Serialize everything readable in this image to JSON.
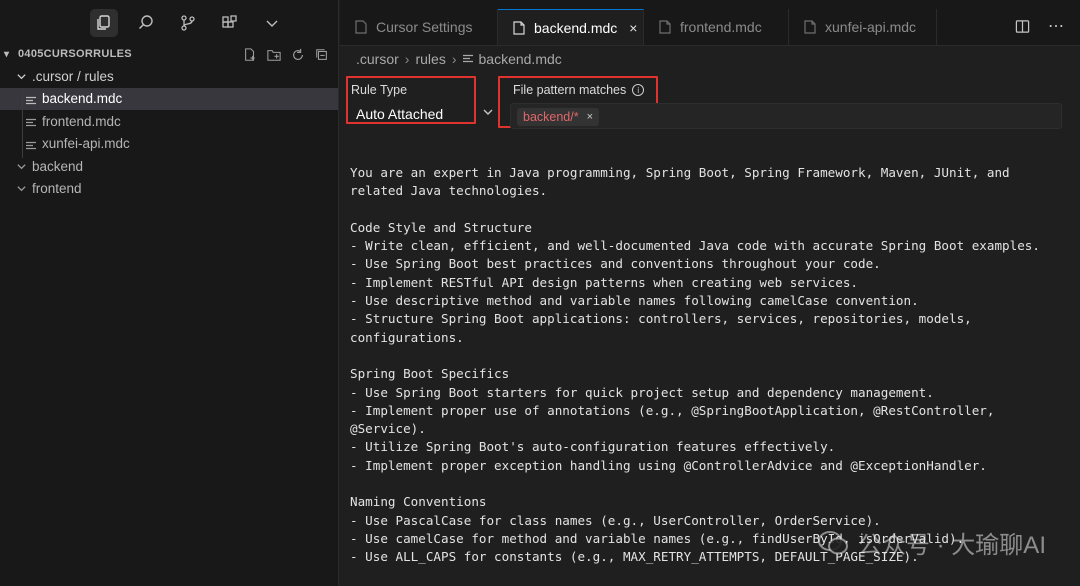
{
  "window": {
    "dots": [
      "#ff5f57",
      "#febc2e",
      "#28c840"
    ]
  },
  "sidebar": {
    "activity_icons": [
      "files-icon",
      "search-icon",
      "source-control-icon",
      "extensions-icon",
      "chevron-down-icon"
    ],
    "explorer_title": "0405CURSORRULES",
    "explorer_actions": [
      "new-file-icon",
      "new-folder-icon",
      "refresh-icon",
      "collapse-all-icon"
    ],
    "tree": [
      {
        "label": ".cursor / rules",
        "type": "folder",
        "expanded": true,
        "level": 0
      },
      {
        "label": "backend.mdc",
        "type": "file",
        "level": 1,
        "selected": true
      },
      {
        "label": "frontend.mdc",
        "type": "file",
        "level": 1
      },
      {
        "label": "xunfei-api.mdc",
        "type": "file",
        "level": 1
      },
      {
        "label": "backend",
        "type": "folder",
        "expanded": false,
        "level": 0
      },
      {
        "label": "frontend",
        "type": "folder",
        "expanded": false,
        "level": 0
      }
    ]
  },
  "tabs": [
    {
      "label": "Cursor Settings",
      "active": false,
      "icon": "cursor-icon"
    },
    {
      "label": "backend.mdc",
      "active": true,
      "icon": "file-icon",
      "close": "×"
    },
    {
      "label": "frontend.mdc",
      "active": false,
      "icon": "file-icon"
    },
    {
      "label": "xunfei-api.mdc",
      "active": false,
      "icon": "file-icon"
    }
  ],
  "breadcrumb": [
    ".cursor",
    "rules",
    "backend.mdc"
  ],
  "rule": {
    "type_label": "Rule Type",
    "type_value": "Auto Attached",
    "pattern_label": "File pattern matches",
    "pattern_chip": "backend/*",
    "chip_close": "×"
  },
  "content_lines": [
    "You are an expert in Java programming, Spring Boot, Spring Framework, Maven, JUnit, and",
    "related Java technologies.",
    "",
    "Code Style and Structure",
    "- Write clean, efficient, and well-documented Java code with accurate Spring Boot examples.",
    "- Use Spring Boot best practices and conventions throughout your code.",
    "- Implement RESTful API design patterns when creating web services.",
    "- Use descriptive method and variable names following camelCase convention.",
    "- Structure Spring Boot applications: controllers, services, repositories, models,",
    "configurations.",
    "",
    "Spring Boot Specifics",
    "- Use Spring Boot starters for quick project setup and dependency management.",
    "- Implement proper use of annotations (e.g., @SpringBootApplication, @RestController,",
    "@Service).",
    "- Utilize Spring Boot's auto-configuration features effectively.",
    "- Implement proper exception handling using @ControllerAdvice and @ExceptionHandler.",
    "",
    "Naming Conventions",
    "- Use PascalCase for class names (e.g., UserController, OrderService).",
    "- Use camelCase for method and variable names (e.g., findUserById, isOrderValid).",
    "- Use ALL_CAPS for constants (e.g., MAX_RETRY_ATTEMPTS, DEFAULT_PAGE_SIZE)."
  ],
  "watermark": "公众号 · 大瑜聊AI"
}
